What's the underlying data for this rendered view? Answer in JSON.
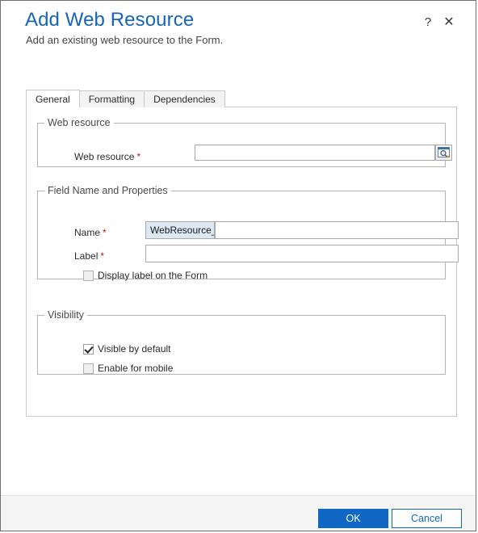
{
  "header": {
    "title": "Add Web Resource",
    "subtitle": "Add an existing web resource to the Form.",
    "help_icon": "question-mark-icon",
    "help_label": "?",
    "close_icon": "close-icon",
    "close_label": "✕"
  },
  "tabs": [
    {
      "label": "General",
      "active": true
    },
    {
      "label": "Formatting",
      "active": false
    },
    {
      "label": "Dependencies",
      "active": false
    }
  ],
  "groups": {
    "web_resource": {
      "legend": "Web resource",
      "field_label": "Web resource",
      "required_marker": "*",
      "value": "",
      "lookup_icon": "lookup-window-search-icon"
    },
    "field_name": {
      "legend": "Field Name and Properties",
      "name_label": "Name",
      "name_required_marker": "*",
      "name_prefix": "WebResource_",
      "name_value": "",
      "label_label": "Label",
      "label_required_marker": "*",
      "label_value": "",
      "display_label_checkbox": {
        "label": "Display label on the Form",
        "checked": false
      }
    },
    "visibility": {
      "legend": "Visibility",
      "visible_by_default": {
        "label": "Visible by default",
        "checked": true
      },
      "enable_for_mobile": {
        "label": "Enable for mobile",
        "checked": false
      }
    }
  },
  "footer": {
    "ok_label": "OK",
    "cancel_label": "Cancel"
  },
  "colors": {
    "title_blue": "#1666b5",
    "accent_blue": "#1168c4",
    "required_red": "#b61a1a",
    "prefix_bg": "#dde8f5",
    "footer_bg": "#f5f5f5"
  }
}
